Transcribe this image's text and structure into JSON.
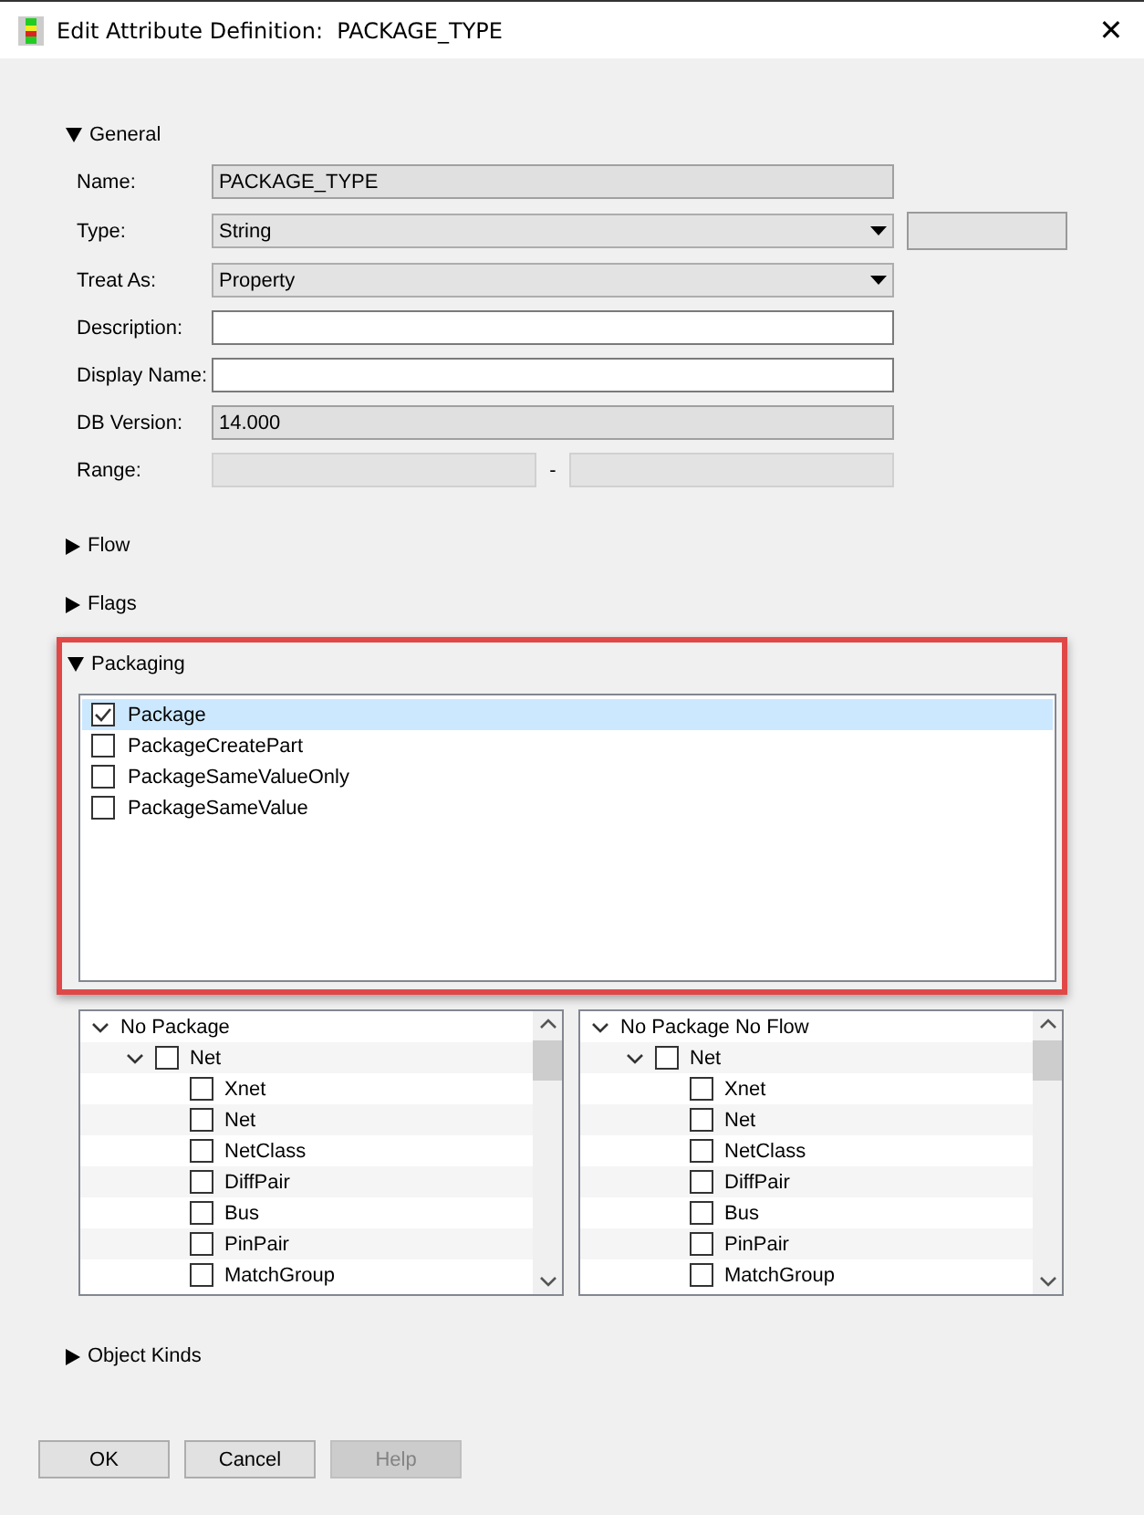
{
  "window": {
    "title": "Edit Attribute Definition:  PACKAGE_TYPE",
    "close": "✕"
  },
  "sections": [
    {
      "kind": "form",
      "label": "General",
      "expanded": true,
      "rows": [
        {
          "label": "Name:",
          "kind": "readonly",
          "value": "PACKAGE_TYPE"
        },
        {
          "label": "Type:",
          "kind": "dropdown",
          "value": "String",
          "extra_field": true
        },
        {
          "label": "Treat As:",
          "kind": "dropdown",
          "value": "Property"
        },
        {
          "label": "Description:",
          "kind": "text"
        },
        {
          "label": "Display Name:",
          "kind": "text"
        },
        {
          "label": "DB Version:",
          "kind": "readonly",
          "value": "14.000"
        },
        {
          "label": "Range:",
          "kind": "range",
          "separator": "-"
        }
      ]
    },
    {
      "kind": "plain",
      "label": "Flow",
      "expanded": false
    },
    {
      "kind": "plain",
      "label": "Flags",
      "expanded": false
    },
    {
      "kind": "checklist",
      "label": "Packaging",
      "expanded": true,
      "highlighted": true,
      "items": [
        {
          "label": "Package",
          "checked": true,
          "selected": true
        },
        {
          "label": "PackageCreatePart",
          "checked": false,
          "selected": false
        },
        {
          "label": "PackageSameValueOnly",
          "checked": false,
          "selected": false
        },
        {
          "label": "PackageSameValue",
          "checked": false,
          "selected": false
        }
      ],
      "trees": [
        {
          "label": "No Package",
          "expanded": true,
          "children": [
            {
              "label": "Net",
              "expanded": true,
              "checked": false,
              "children": [
                {
                  "label": "Xnet",
                  "checked": false
                },
                {
                  "label": "Net",
                  "checked": false
                },
                {
                  "label": "NetClass",
                  "checked": false
                },
                {
                  "label": "DiffPair",
                  "checked": false
                },
                {
                  "label": "Bus",
                  "checked": false
                },
                {
                  "label": "PinPair",
                  "checked": false
                },
                {
                  "label": "MatchGroup",
                  "checked": false
                }
              ]
            }
          ]
        },
        {
          "label": "No Package No Flow",
          "expanded": true,
          "children": [
            {
              "label": "Net",
              "expanded": true,
              "checked": false,
              "children": [
                {
                  "label": "Xnet",
                  "checked": false
                },
                {
                  "label": "Net",
                  "checked": false
                },
                {
                  "label": "NetClass",
                  "checked": false
                },
                {
                  "label": "DiffPair",
                  "checked": false
                },
                {
                  "label": "Bus",
                  "checked": false
                },
                {
                  "label": "PinPair",
                  "checked": false
                },
                {
                  "label": "MatchGroup",
                  "checked": false
                }
              ]
            }
          ]
        }
      ]
    },
    {
      "kind": "plain",
      "label": "Object Kinds",
      "expanded": false
    }
  ],
  "buttons": [
    {
      "label": "OK",
      "disabled": false
    },
    {
      "label": "Cancel",
      "disabled": false
    },
    {
      "label": "Help",
      "disabled": true
    }
  ]
}
